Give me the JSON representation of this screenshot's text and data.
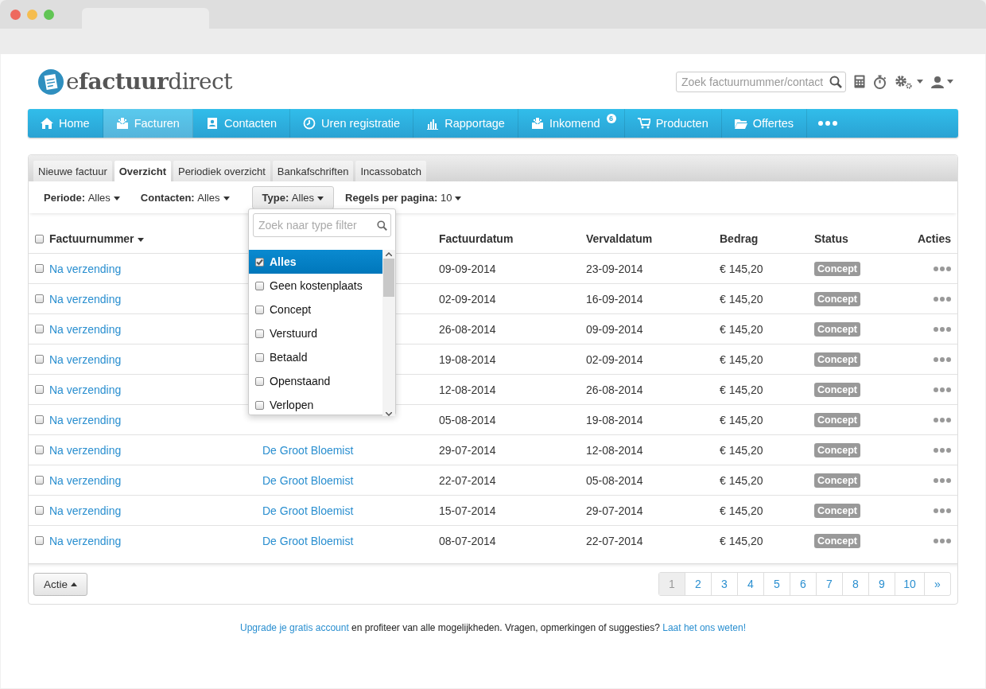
{
  "logo": {
    "text": "e**factuur**direct"
  },
  "search": {
    "placeholder": "Zoek factuurnummer/contact"
  },
  "nav": [
    {
      "label": "Home",
      "kind": "home",
      "selected": false
    },
    {
      "label": "Facturen",
      "kind": "inbox",
      "selected": true
    },
    {
      "label": "Contacten",
      "kind": "card",
      "selected": false
    },
    {
      "label": "Uren registratie",
      "kind": "clock",
      "selected": false
    },
    {
      "label": "Rapportage",
      "kind": "chart",
      "selected": false
    },
    {
      "label": "Inkomend",
      "kind": "inbox",
      "selected": false,
      "badge": "6"
    },
    {
      "label": "Producten",
      "kind": "cart",
      "selected": false
    },
    {
      "label": "Offertes",
      "kind": "folder",
      "selected": false
    }
  ],
  "tabs": [
    {
      "label": "Nieuwe factuur",
      "selected": false
    },
    {
      "label": "Overzicht",
      "selected": true
    },
    {
      "label": "Periodiek overzicht",
      "selected": false
    },
    {
      "label": "Bankafschriften",
      "selected": false
    },
    {
      "label": "Incassobatch",
      "selected": false
    }
  ],
  "filters": [
    {
      "label": "Periode:",
      "value": "Alles",
      "open": false
    },
    {
      "label": "Contacten:",
      "value": "Alles",
      "open": false
    },
    {
      "label": "Type:",
      "value": "Alles",
      "open": true
    },
    {
      "label": "Regels per pagina:",
      "value": "10",
      "open": false
    }
  ],
  "type_dropdown": {
    "placeholder": "Zoek naar type filter",
    "options": [
      {
        "label": "Alles",
        "checked": true,
        "selected": true
      },
      {
        "label": "Geen kostenplaats",
        "checked": false,
        "selected": false
      },
      {
        "label": "Concept",
        "checked": false,
        "selected": false
      },
      {
        "label": "Verstuurd",
        "checked": false,
        "selected": false
      },
      {
        "label": "Betaald",
        "checked": false,
        "selected": false
      },
      {
        "label": "Openstaand",
        "checked": false,
        "selected": false
      },
      {
        "label": "Verlopen",
        "checked": false,
        "selected": false
      }
    ]
  },
  "table": {
    "all_checked": false,
    "columns": [
      {
        "label": "Factuurnummer",
        "sorted": true
      },
      {
        "label": "Factuurdatum",
        "sorted": false
      },
      {
        "label": "Vervaldatum",
        "sorted": false
      },
      {
        "label": "Bedrag",
        "sorted": false
      },
      {
        "label": "Status",
        "sorted": false
      },
      {
        "label": "Acties",
        "sorted": false
      }
    ],
    "rows": [
      {
        "checked": false,
        "number": "Na verzending",
        "invoice_date": "09-09-2014",
        "due_date": "23-09-2014",
        "amount": "€ 145,20",
        "status": "Concept"
      },
      {
        "checked": false,
        "number": "Na verzending",
        "invoice_date": "02-09-2014",
        "due_date": "16-09-2014",
        "amount": "€ 145,20",
        "status": "Concept"
      },
      {
        "checked": false,
        "number": "Na verzending",
        "invoice_date": "26-08-2014",
        "due_date": "09-09-2014",
        "amount": "€ 145,20",
        "status": "Concept"
      },
      {
        "checked": false,
        "number": "Na verzending",
        "invoice_date": "19-08-2014",
        "due_date": "02-09-2014",
        "amount": "€ 145,20",
        "status": "Concept"
      },
      {
        "checked": false,
        "number": "Na verzending",
        "invoice_date": "12-08-2014",
        "due_date": "26-08-2014",
        "amount": "€ 145,20",
        "status": "Concept"
      },
      {
        "checked": false,
        "number": "Na verzending",
        "invoice_date": "05-08-2014",
        "due_date": "19-08-2014",
        "amount": "€ 145,20",
        "status": "Concept"
      },
      {
        "checked": false,
        "number": "Na verzending",
        "contact": "De Groot Bloemist",
        "invoice_date": "29-07-2014",
        "due_date": "12-08-2014",
        "amount": "€ 145,20",
        "status": "Concept"
      },
      {
        "checked": false,
        "number": "Na verzending",
        "contact": "De Groot Bloemist",
        "invoice_date": "22-07-2014",
        "due_date": "05-08-2014",
        "amount": "€ 145,20",
        "status": "Concept"
      },
      {
        "checked": false,
        "number": "Na verzending",
        "contact": "De Groot Bloemist",
        "invoice_date": "15-07-2014",
        "due_date": "29-07-2014",
        "amount": "€ 145,20",
        "status": "Concept"
      },
      {
        "checked": false,
        "number": "Na verzending",
        "contact": "De Groot Bloemist",
        "invoice_date": "08-07-2014",
        "due_date": "22-07-2014",
        "amount": "€ 145,20",
        "status": "Concept"
      }
    ]
  },
  "action_button": "Actie",
  "pagination": [
    {
      "label": "1",
      "selected": true
    },
    {
      "label": "2",
      "selected": false
    },
    {
      "label": "3",
      "selected": false
    },
    {
      "label": "4",
      "selected": false
    },
    {
      "label": "5",
      "selected": false
    },
    {
      "label": "6",
      "selected": false
    },
    {
      "label": "7",
      "selected": false
    },
    {
      "label": "8",
      "selected": false
    },
    {
      "label": "9",
      "selected": false
    },
    {
      "label": "10",
      "selected": false
    },
    {
      "label": "»",
      "selected": false
    }
  ],
  "footer": {
    "link_1": "Upgrade je gratis account",
    "text": " en profiteer van alle mogelijkheden. Vragen, opmerkingen of suggesties? ",
    "link_2": "Laat het ons weten!"
  }
}
